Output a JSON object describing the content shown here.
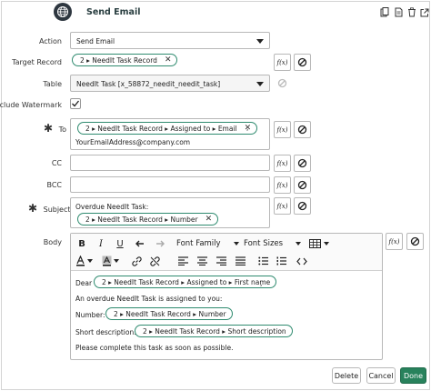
{
  "header": {
    "title": "Send Email",
    "icons": [
      "globe-icon",
      "attachment-icon",
      "copy-icon",
      "trash-icon",
      "open-external-icon"
    ]
  },
  "fields": {
    "action": {
      "label": "Action",
      "value": "Send Email"
    },
    "target_record": {
      "label": "Target Record",
      "pill": "2 ▸ NeedIt Task Record"
    },
    "table": {
      "label": "Table",
      "value": "NeedIt Task [x_58872_needit_needit_task]"
    },
    "watermark": {
      "label": "Include Watermark",
      "checked": true
    },
    "to": {
      "label": "To",
      "pill": "2 ▸ NeedIt Task Record ▸ Assigned to ▸ Email",
      "comma": ",",
      "extra": "YourEmailAddress@company.com"
    },
    "cc": {
      "label": "CC"
    },
    "bcc": {
      "label": "BCC"
    },
    "subject": {
      "label": "Subject",
      "text": "Overdue NeedIt Task:",
      "pill": "2 ▸ NeedIt Task Record ▸ Number"
    },
    "body": {
      "label": "Body"
    }
  },
  "formula_label": "f(x)",
  "required_mark": "✱",
  "toolbar": {
    "bold": "B",
    "italic": "I",
    "underline": "U",
    "font_family": "Font Family",
    "font_sizes": "Font Sizes"
  },
  "body_content": {
    "dear": "Dear",
    "dear_pill": "2 ▸ NeedIt Task Record ▸ Assigned to ▸ First name",
    "dear_comma": ",",
    "line2": "An overdue NeedIt Task is assigned to you:",
    "number_label": "Number:",
    "number_pill": "2 ▸ NeedIt Task Record ▸ Number",
    "short_label": "Short description:",
    "short_pill": "2 ▸ NeedIt Task Record ▸ Short description",
    "closing": "Please complete this task as soon as possible."
  },
  "buttons": {
    "delete": "Delete",
    "cancel": "Cancel",
    "done": "Done"
  },
  "colors": {
    "accent": "#28825c",
    "pill_border": "#2f8b6f",
    "header_title": "#293e40"
  }
}
